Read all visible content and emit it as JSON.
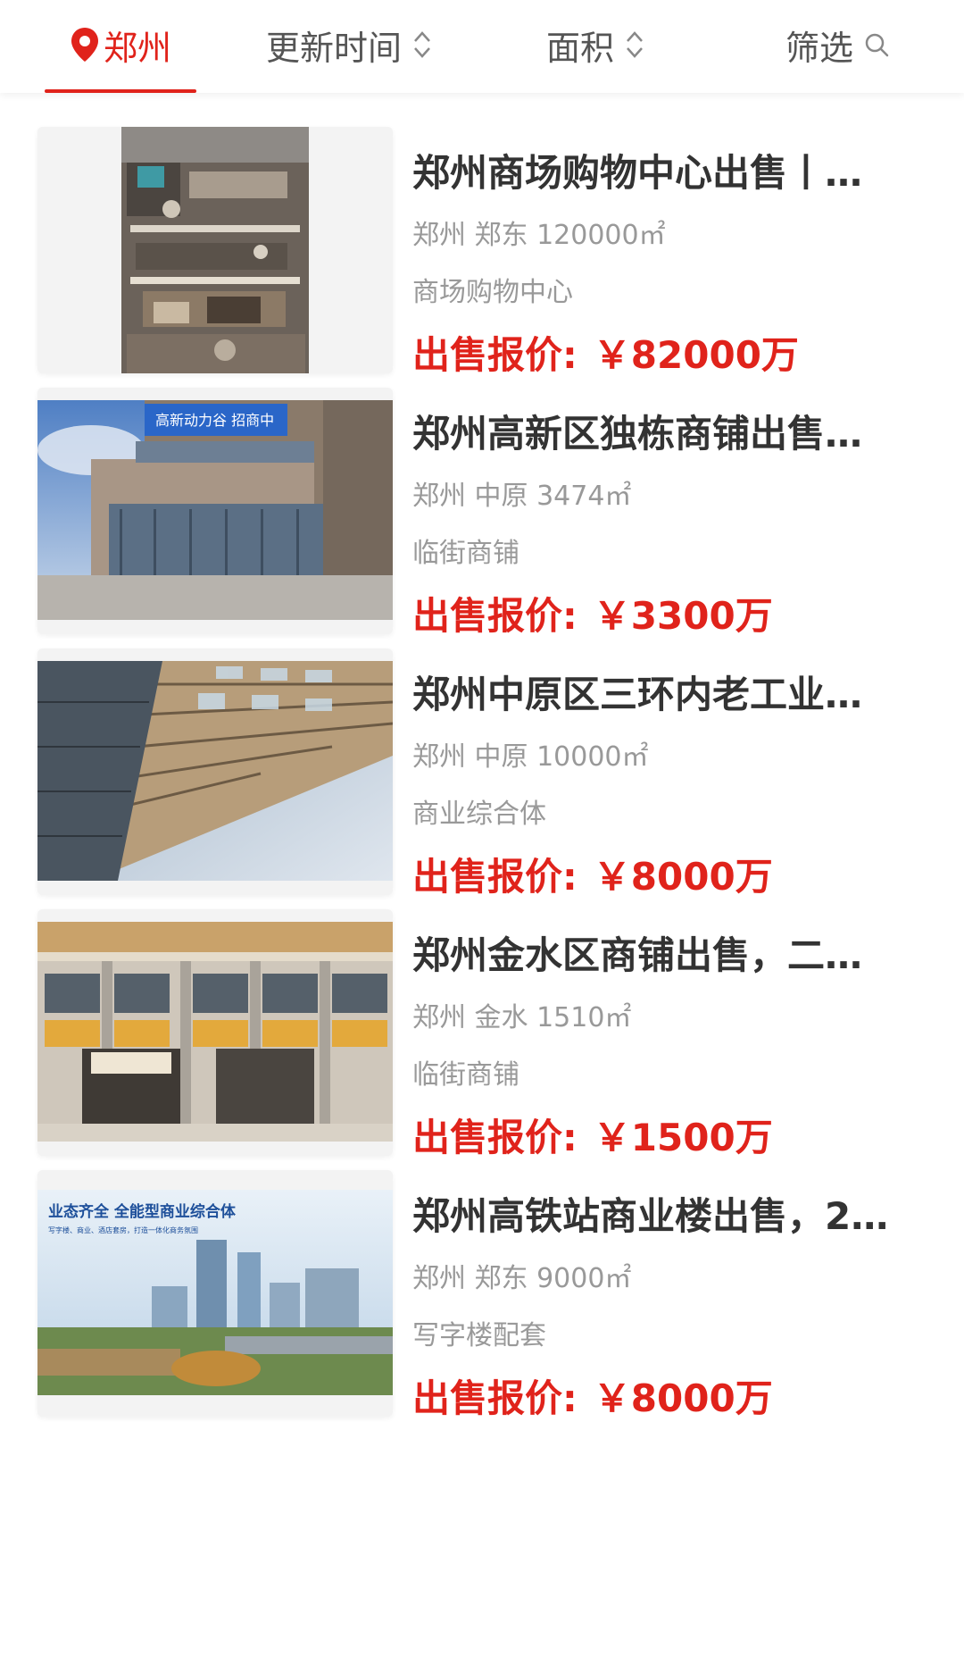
{
  "colors": {
    "accent": "#e0231b",
    "title": "#333333",
    "meta": "#999999",
    "tab_text": "#555555"
  },
  "filter_bar": {
    "city": "郑州",
    "update_time": "更新时间",
    "area": "面积",
    "filter": "筛选",
    "icons": [
      "location-pin-icon",
      "sort-updown-icon",
      "sort-updown-icon",
      "search-icon"
    ]
  },
  "listings": [
    {
      "title": "郑州商场购物中心出售丨…",
      "location": "郑州 郑东 120000㎡",
      "type": "商场购物中心",
      "price_label": "出售报价:",
      "price_value": "￥82000万"
    },
    {
      "title": "郑州高新区独栋商铺出售…",
      "location": "郑州 中原 3474㎡",
      "type": "临街商铺",
      "price_label": "出售报价:",
      "price_value": "￥3300万"
    },
    {
      "title": "郑州中原区三环内老工业…",
      "location": "郑州 中原 10000㎡",
      "type": "商业综合体",
      "price_label": "出售报价:",
      "price_value": "￥8000万"
    },
    {
      "title": "郑州金水区商铺出售，二…",
      "location": "郑州 金水 1510㎡",
      "type": "临街商铺",
      "price_label": "出售报价:",
      "price_value": "￥1500万"
    },
    {
      "title": "郑州高铁站商业楼出售，2…",
      "location": "郑州 郑东 9000㎡",
      "type": "写字楼配套",
      "price_label": "出售报价:",
      "price_value": "￥8000万"
    }
  ],
  "image_texts": {
    "sign_2": "高新动力谷 招商中",
    "banner_5_headline": "业态齐全  全能型商业综合体",
    "banner_5_sub": "写字楼、商业、酒店套房，打造一体化商务氛围"
  }
}
